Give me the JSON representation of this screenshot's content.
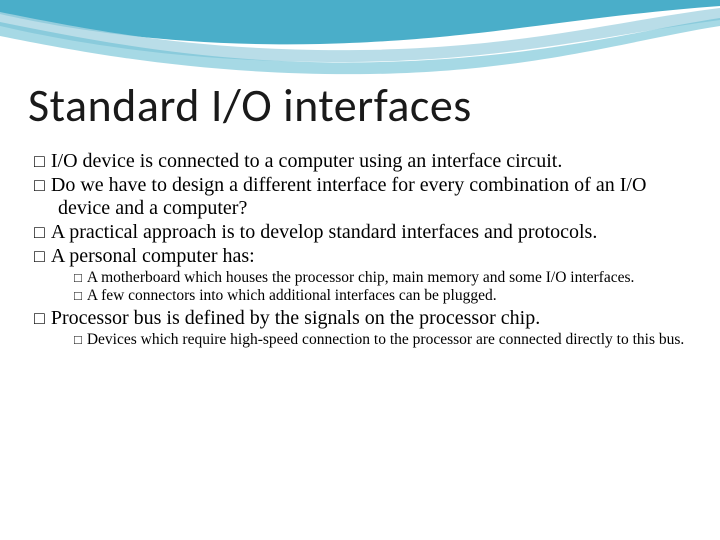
{
  "title": "Standard I/O interfaces",
  "bullets": {
    "b1": "I/O device is connected to a computer using an interface circuit.",
    "b2": "Do we have to design a different interface for every combination of an I/O device and a computer?",
    "b3": "A practical approach is to develop standard interfaces and protocols.",
    "b4": "A personal computer has:",
    "b4a": "A motherboard which houses the processor chip, main memory and some I/O interfaces.",
    "b4b": "A few connectors into which additional interfaces can be plugged.",
    "b5": "Processor bus is defined by the signals on the processor chip.",
    "b5a": "Devices which require high-speed connection to the processor are connected directly to this bus."
  },
  "theme": {
    "swoosh_top": "#2aa0bf",
    "swoosh_light": "#a8d5e2"
  }
}
